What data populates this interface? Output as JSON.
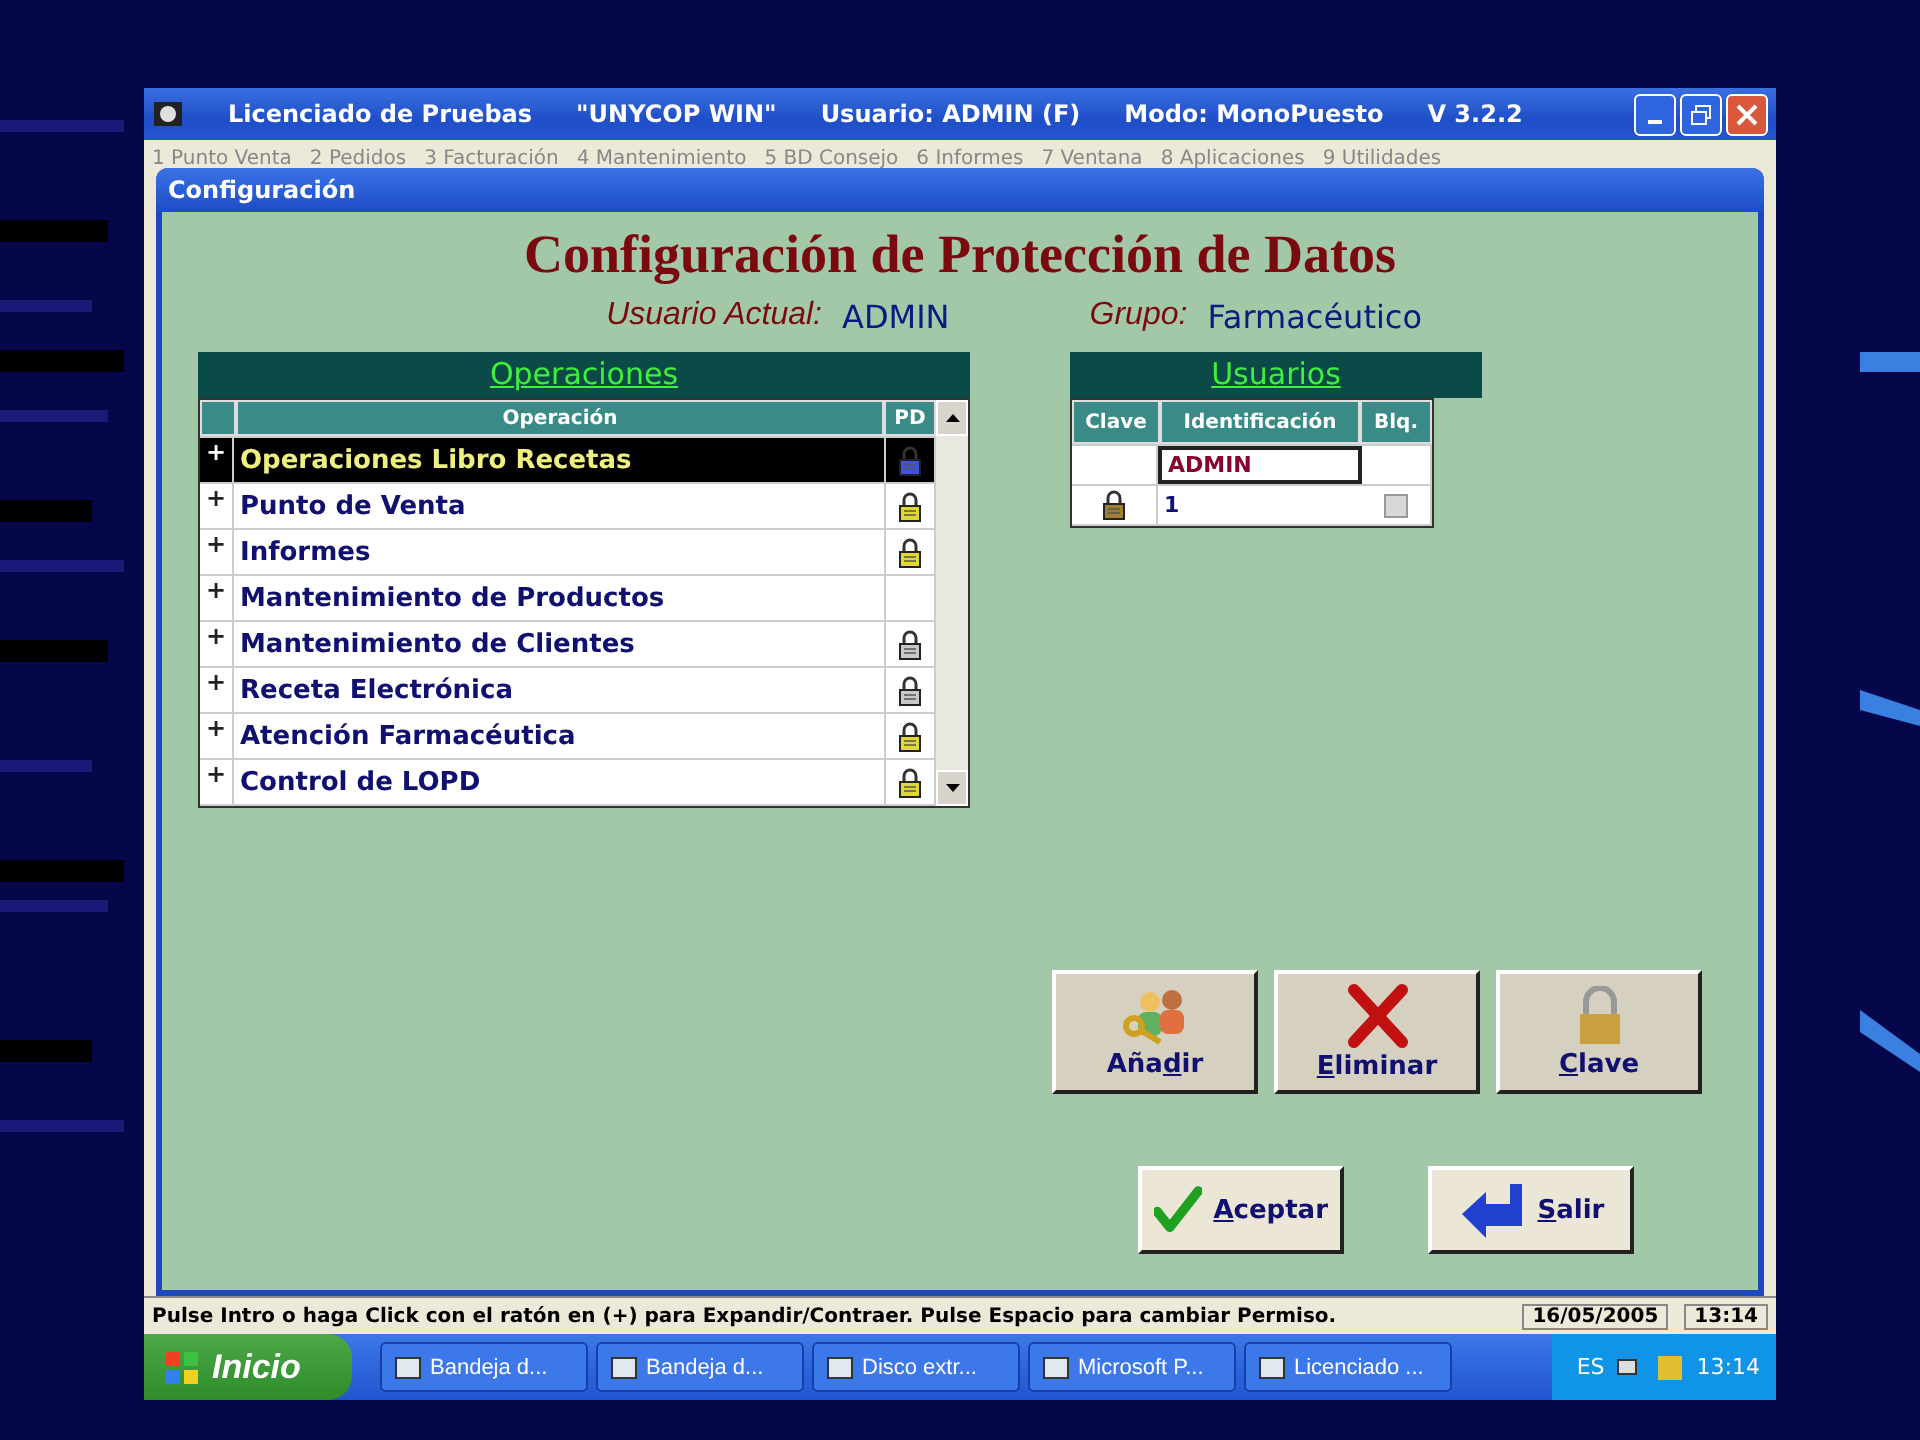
{
  "main_window": {
    "title_parts": [
      "Licenciado de Pruebas",
      "\"UNYCOP WIN\"",
      "Usuario: ADMIN (F)",
      "Modo: MonoPuesto",
      "V 3.2.2"
    ]
  },
  "menu": [
    "1 Punto Venta",
    "2 Pedidos",
    "3 Facturación",
    "4 Mantenimiento",
    "5 BD Consejo",
    "6 Informes",
    "7 Ventana",
    "8 Aplicaciones",
    "9 Utilidades"
  ],
  "dialog": {
    "title": "Configuración",
    "heading": "Configuración de Protección de Datos",
    "current_user": {
      "label": "Usuario Actual:",
      "value": "ADMIN"
    },
    "group": {
      "label": "Grupo:",
      "value": "Farmacéutico"
    },
    "operations": {
      "title": "Operaciones",
      "columns": [
        "Operación",
        "PD"
      ],
      "rows": [
        {
          "expander": "+",
          "name": "Operaciones Libro Recetas",
          "color": "#4050e0",
          "selected": true
        },
        {
          "expander": "+",
          "name": "Punto de Venta",
          "color": "#e0d830",
          "selected": false
        },
        {
          "expander": "+",
          "name": "Informes",
          "color": "#e0d830",
          "selected": false
        },
        {
          "expander": "+",
          "name": "Mantenimiento de Productos",
          "selected": false
        },
        {
          "expander": "+",
          "name": "Mantenimiento de Clientes",
          "color": "#c8c8c8",
          "selected": false
        },
        {
          "expander": "+",
          "name": "Receta Electrónica",
          "color": "#c8c8c8",
          "selected": false
        },
        {
          "expander": "+",
          "name": "Atención Farmacéutica",
          "color": "#e0d830",
          "selected": false
        },
        {
          "expander": "+",
          "name": "Control de LOPD",
          "color": "#e0d830",
          "selected": false
        }
      ]
    },
    "users": {
      "title": "Usuarios",
      "columns": [
        "Clave",
        "Identificación",
        "Blq."
      ],
      "rows": [
        {
          "locked": false,
          "id": "ADMIN",
          "selected": true
        },
        {
          "locked": true,
          "id": "1",
          "selected": false,
          "blocked": false
        }
      ]
    },
    "buttons": [
      {
        "kind": "add",
        "before": "Aña",
        "mnemonic": "d",
        "after": "ir"
      },
      {
        "kind": "delete",
        "mnemonic": "E",
        "after": "liminar"
      },
      {
        "kind": "password",
        "mnemonic": "C",
        "after": "lave"
      }
    ],
    "footer_buttons": [
      {
        "kind": "accept",
        "mnemonic": "A",
        "after": "ceptar"
      },
      {
        "kind": "exit",
        "mnemonic": "S",
        "after": "alir"
      }
    ]
  },
  "status_bar": {
    "message": "Pulse Intro o haga Click con el ratón en (+) para Expandir/Contraer. Pulse Espacio para cambiar Permiso.",
    "date": "16/05/2005",
    "time": "13:14"
  },
  "taskbar": {
    "start": "Inicio",
    "items": [
      "Bandeja d...",
      "Bandeja d...",
      "Disco extr...",
      "Microsoft P...",
      "Licenciado ..."
    ],
    "language": "ES",
    "clock": "13:14"
  }
}
